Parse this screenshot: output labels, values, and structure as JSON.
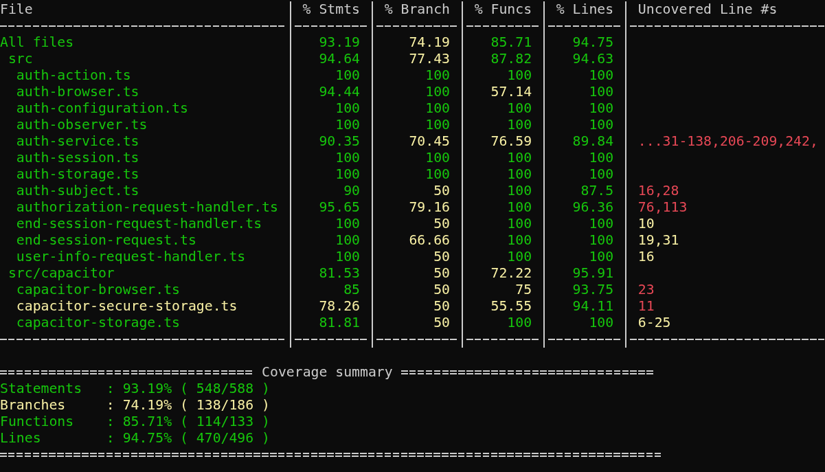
{
  "table": {
    "columns": [
      "File",
      "% Stmts",
      "% Branch",
      "% Funcs",
      "% Lines",
      "Uncovered Line #s"
    ],
    "rows": [
      {
        "cells": [
          {
            "text": "All files",
            "color": "#16c60c"
          },
          {
            "text": "93.19",
            "color": "#16c60c"
          },
          {
            "text": "74.19",
            "color": "#f9f1a5"
          },
          {
            "text": "85.71",
            "color": "#16c60c"
          },
          {
            "text": "94.75",
            "color": "#16c60c"
          }
        ],
        "children": [
          {
            "cells": [
              {
                "text": "src",
                "color": "#16c60c"
              },
              {
                "text": "94.64",
                "color": "#16c60c"
              },
              {
                "text": "77.43",
                "color": "#f9f1a5"
              },
              {
                "text": "87.82",
                "color": "#16c60c"
              },
              {
                "text": "94.63",
                "color": "#16c60c"
              }
            ],
            "children": [
              {
                "cells": [
                  {
                    "text": "auth-action.ts",
                    "color": "#16c60c"
                  },
                  {
                    "text": "100",
                    "color": "#16c60c"
                  },
                  {
                    "text": "100",
                    "color": "#16c60c"
                  },
                  {
                    "text": "100",
                    "color": "#16c60c"
                  },
                  {
                    "text": "100",
                    "color": "#16c60c"
                  }
                ]
              },
              {
                "cells": [
                  {
                    "text": "auth-browser.ts",
                    "color": "#16c60c"
                  },
                  {
                    "text": "94.44",
                    "color": "#16c60c"
                  },
                  {
                    "text": "100",
                    "color": "#16c60c"
                  },
                  {
                    "text": "57.14",
                    "color": "#f9f1a5"
                  },
                  {
                    "text": "100",
                    "color": "#16c60c"
                  }
                ]
              },
              {
                "cells": [
                  {
                    "text": "auth-configuration.ts",
                    "color": "#16c60c"
                  },
                  {
                    "text": "100",
                    "color": "#16c60c"
                  },
                  {
                    "text": "100",
                    "color": "#16c60c"
                  },
                  {
                    "text": "100",
                    "color": "#16c60c"
                  },
                  {
                    "text": "100",
                    "color": "#16c60c"
                  }
                ]
              },
              {
                "cells": [
                  {
                    "text": "auth-observer.ts",
                    "color": "#16c60c"
                  },
                  {
                    "text": "100",
                    "color": "#16c60c"
                  },
                  {
                    "text": "100",
                    "color": "#16c60c"
                  },
                  {
                    "text": "100",
                    "color": "#16c60c"
                  },
                  {
                    "text": "100",
                    "color": "#16c60c"
                  }
                ]
              },
              {
                "cells": [
                  {
                    "text": "auth-service.ts",
                    "color": "#16c60c"
                  },
                  {
                    "text": "90.35",
                    "color": "#16c60c"
                  },
                  {
                    "text": "70.45",
                    "color": "#f9f1a5"
                  },
                  {
                    "text": "76.59",
                    "color": "#f9f1a5"
                  },
                  {
                    "text": "89.84",
                    "color": "#16c60c"
                  },
                  {
                    "text": "...31-138,206-209,242,",
                    "color": "#e74856"
                  }
                ]
              },
              {
                "cells": [
                  {
                    "text": "auth-session.ts",
                    "color": "#16c60c"
                  },
                  {
                    "text": "100",
                    "color": "#16c60c"
                  },
                  {
                    "text": "100",
                    "color": "#16c60c"
                  },
                  {
                    "text": "100",
                    "color": "#16c60c"
                  },
                  {
                    "text": "100",
                    "color": "#16c60c"
                  }
                ]
              },
              {
                "cells": [
                  {
                    "text": "auth-storage.ts",
                    "color": "#16c60c"
                  },
                  {
                    "text": "100",
                    "color": "#16c60c"
                  },
                  {
                    "text": "100",
                    "color": "#16c60c"
                  },
                  {
                    "text": "100",
                    "color": "#16c60c"
                  },
                  {
                    "text": "100",
                    "color": "#16c60c"
                  }
                ]
              },
              {
                "cells": [
                  {
                    "text": "auth-subject.ts",
                    "color": "#16c60c"
                  },
                  {
                    "text": "90",
                    "color": "#16c60c"
                  },
                  {
                    "text": "50",
                    "color": "#f9f1a5"
                  },
                  {
                    "text": "100",
                    "color": "#16c60c"
                  },
                  {
                    "text": "87.5",
                    "color": "#16c60c"
                  },
                  {
                    "text": "16,28",
                    "color": "#e74856"
                  }
                ]
              },
              {
                "cells": [
                  {
                    "text": "authorization-request-handler.ts",
                    "color": "#16c60c"
                  },
                  {
                    "text": "95.65",
                    "color": "#16c60c"
                  },
                  {
                    "text": "79.16",
                    "color": "#f9f1a5"
                  },
                  {
                    "text": "100",
                    "color": "#16c60c"
                  },
                  {
                    "text": "96.36",
                    "color": "#16c60c"
                  },
                  {
                    "text": "76,113",
                    "color": "#e74856"
                  }
                ]
              },
              {
                "cells": [
                  {
                    "text": "end-session-request-handler.ts",
                    "color": "#16c60c"
                  },
                  {
                    "text": "100",
                    "color": "#16c60c"
                  },
                  {
                    "text": "50",
                    "color": "#f9f1a5"
                  },
                  {
                    "text": "100",
                    "color": "#16c60c"
                  },
                  {
                    "text": "100",
                    "color": "#16c60c"
                  },
                  {
                    "text": "10",
                    "color": "#f9f1a5"
                  }
                ]
              },
              {
                "cells": [
                  {
                    "text": "end-session-request.ts",
                    "color": "#16c60c"
                  },
                  {
                    "text": "100",
                    "color": "#16c60c"
                  },
                  {
                    "text": "66.66",
                    "color": "#f9f1a5"
                  },
                  {
                    "text": "100",
                    "color": "#16c60c"
                  },
                  {
                    "text": "100",
                    "color": "#16c60c"
                  },
                  {
                    "text": "19,31",
                    "color": "#f9f1a5"
                  }
                ]
              },
              {
                "cells": [
                  {
                    "text": "user-info-request-handler.ts",
                    "color": "#16c60c"
                  },
                  {
                    "text": "100",
                    "color": "#16c60c"
                  },
                  {
                    "text": "50",
                    "color": "#f9f1a5"
                  },
                  {
                    "text": "100",
                    "color": "#16c60c"
                  },
                  {
                    "text": "100",
                    "color": "#16c60c"
                  },
                  {
                    "text": "16",
                    "color": "#f9f1a5"
                  }
                ]
              }
            ]
          },
          {
            "cells": [
              {
                "text": "src/capacitor",
                "color": "#16c60c"
              },
              {
                "text": "81.53",
                "color": "#16c60c"
              },
              {
                "text": "50",
                "color": "#f9f1a5"
              },
              {
                "text": "72.22",
                "color": "#f9f1a5"
              },
              {
                "text": "95.91",
                "color": "#16c60c"
              }
            ],
            "children": [
              {
                "cells": [
                  {
                    "text": "capacitor-browser.ts",
                    "color": "#16c60c"
                  },
                  {
                    "text": "85",
                    "color": "#16c60c"
                  },
                  {
                    "text": "50",
                    "color": "#f9f1a5"
                  },
                  {
                    "text": "75",
                    "color": "#f9f1a5"
                  },
                  {
                    "text": "93.75",
                    "color": "#16c60c"
                  },
                  {
                    "text": "23",
                    "color": "#e74856"
                  }
                ]
              },
              {
                "cells": [
                  {
                    "text": "capacitor-secure-storage.ts",
                    "color": "#f9f1a5"
                  },
                  {
                    "text": "78.26",
                    "color": "#f9f1a5"
                  },
                  {
                    "text": "50",
                    "color": "#f9f1a5"
                  },
                  {
                    "text": "55.55",
                    "color": "#f9f1a5"
                  },
                  {
                    "text": "94.11",
                    "color": "#16c60c"
                  },
                  {
                    "text": "11",
                    "color": "#e74856"
                  }
                ]
              },
              {
                "cells": [
                  {
                    "text": "capacitor-storage.ts",
                    "color": "#16c60c"
                  },
                  {
                    "text": "81.81",
                    "color": "#16c60c"
                  },
                  {
                    "text": "50",
                    "color": "#f9f1a5"
                  },
                  {
                    "text": "100",
                    "color": "#16c60c"
                  },
                  {
                    "text": "100",
                    "color": "#16c60c"
                  },
                  {
                    "text": "6-25",
                    "color": "#f9f1a5"
                  }
                ]
              }
            ]
          }
        ]
      }
    ]
  },
  "summary": {
    "title": "Coverage summary",
    "items": [
      {
        "label": "Statements",
        "value": ": 93.19% ( 548/588 )",
        "color": "#16c60c"
      },
      {
        "label": "Branches",
        "value": ": 74.19% ( 138/186 )",
        "color": "#f9f1a5"
      },
      {
        "label": "Functions",
        "value": ": 85.71% ( 114/133 )",
        "color": "#16c60c"
      },
      {
        "label": "Lines",
        "value": ": 94.75% ( 470/496 )",
        "color": "#16c60c"
      }
    ]
  }
}
